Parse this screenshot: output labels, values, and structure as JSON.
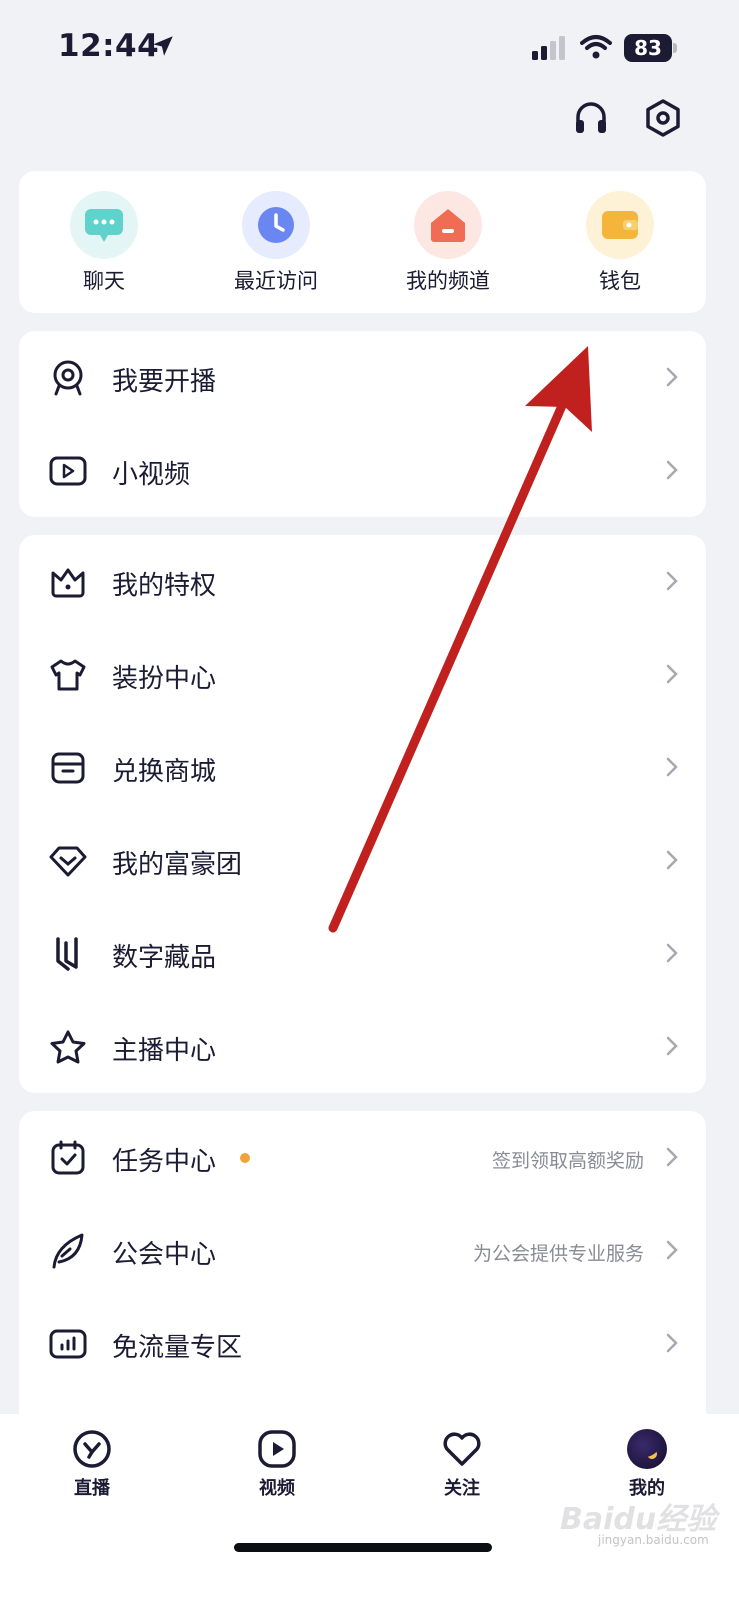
{
  "status_bar": {
    "time": "12:44",
    "battery": "83"
  },
  "quick_actions": [
    {
      "label": "聊天",
      "icon": "chat-bubble-icon",
      "color": "#5fd3cb"
    },
    {
      "label": "最近访问",
      "icon": "clock-icon",
      "color": "#6a86f0"
    },
    {
      "label": "我的频道",
      "icon": "house-icon",
      "color": "#ef6d55"
    },
    {
      "label": "钱包",
      "icon": "wallet-icon",
      "color": "#f5b53a"
    }
  ],
  "group1": [
    {
      "label": "我要开播",
      "icon": "camera-icon"
    },
    {
      "label": "小视频",
      "icon": "video-icon"
    }
  ],
  "group2": [
    {
      "label": "我的特权",
      "icon": "crown-icon"
    },
    {
      "label": "装扮中心",
      "icon": "tshirt-icon"
    },
    {
      "label": "兑换商城",
      "icon": "store-icon"
    },
    {
      "label": "我的富豪团",
      "icon": "diamond-icon"
    },
    {
      "label": "数字藏品",
      "icon": "collectible-icon"
    },
    {
      "label": "主播中心",
      "icon": "star-icon"
    }
  ],
  "group3": [
    {
      "label": "任务中心",
      "icon": "calendar-check-icon",
      "subtitle": "签到领取高额奖励",
      "has_dot": true
    },
    {
      "label": "公会中心",
      "icon": "feather-icon",
      "subtitle": "为公会提供专业服务"
    },
    {
      "label": "免流量专区",
      "icon": "data-chart-icon",
      "subtitle": ""
    }
  ],
  "tabs": [
    {
      "label": "直播",
      "icon": "live-icon"
    },
    {
      "label": "视频",
      "icon": "play-icon"
    },
    {
      "label": "关注",
      "icon": "heart-icon"
    },
    {
      "label": "我的",
      "icon": "avatar"
    }
  ],
  "watermark": {
    "brand": "Baidu经验",
    "domain": "jingyan.baidu.com"
  },
  "colors": {
    "background": "#f1f2f6",
    "card": "#ffffff",
    "text": "#1b1c33",
    "annotation_arrow": "#c0201e",
    "dot": "#f0a33a"
  }
}
